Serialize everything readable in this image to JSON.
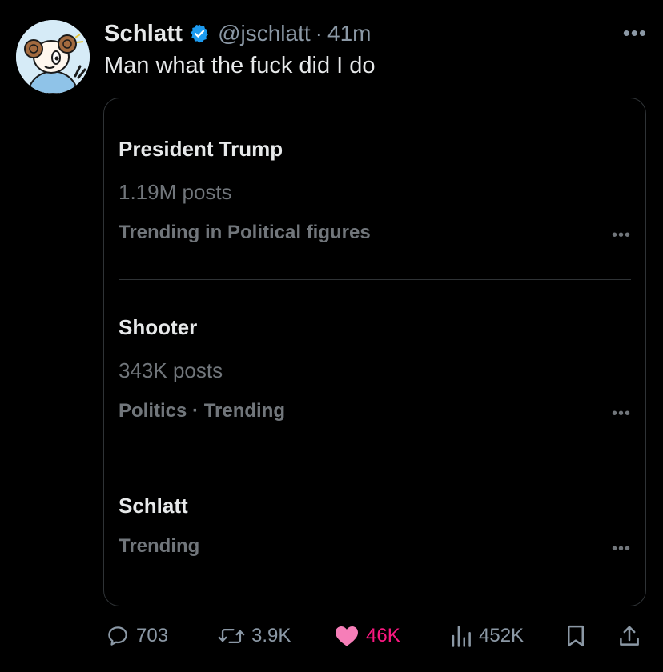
{
  "tweet": {
    "author_name": "Schlatt",
    "handle": "@jschlatt",
    "separator": "·",
    "time": "41m",
    "more_label": "•••",
    "text": "Man what the fuck did I do"
  },
  "trends": [
    {
      "title": "President Trump",
      "count": "1.19M posts",
      "context": "Trending in Political figures",
      "more": "•••"
    },
    {
      "title": "Shooter",
      "count": "343K posts",
      "context": "Politics · Trending",
      "more": "•••"
    },
    {
      "title": "Schlatt",
      "count": "",
      "context": "Trending",
      "more": "•••"
    }
  ],
  "actions": {
    "replies": "703",
    "reposts": "3.9K",
    "likes": "46K",
    "views": "452K"
  },
  "colors": {
    "background": "#000000",
    "text": "#e7e9ea",
    "muted": "#71767b",
    "verified": "#1d9bf0",
    "like": "#f91880",
    "border": "#2f3336"
  },
  "icons": [
    "verified-badge-icon",
    "more-icon",
    "reply-icon",
    "repost-icon",
    "like-icon",
    "views-icon",
    "bookmark-icon",
    "share-icon"
  ]
}
